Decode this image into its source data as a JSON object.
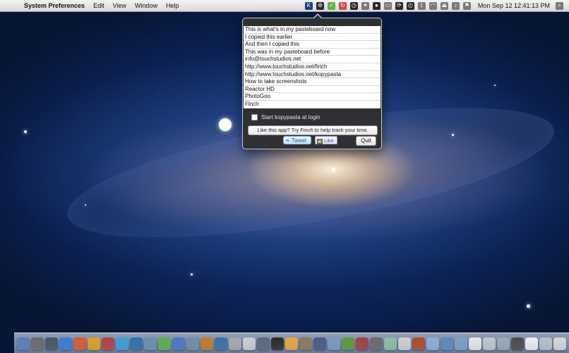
{
  "menubar": {
    "apple_symbol": "",
    "app_name": "System Preferences",
    "menus": [
      "Edit",
      "View",
      "Window",
      "Help"
    ],
    "status_icons": [
      "kopypasta-icon",
      "gear-icon",
      "check-icon",
      "refresh-icon",
      "clock-icon",
      "tools-icon",
      "bubble-icon",
      "window-icon",
      "sync-icon",
      "timemachine-icon",
      "bluetooth-icon",
      "wifi-icon",
      "eject-icon",
      "volume-icon",
      "flag-icon"
    ],
    "datetime": "Mon Sep 12  12:41:13 PM",
    "search_icon": "spotlight-icon"
  },
  "popover": {
    "clipboard_items": [
      "This is what's in my pasteboard now",
      "I copied this earlier",
      "And then I copied this",
      "This was in my pasteboard before",
      "info@touchstudios.net",
      "http://www.touchstudios.net/finch",
      "http://www.touchstudios.net/kopypasta",
      "How to take screenshots",
      "Reactor HD",
      "PhotoGoo",
      "Finch"
    ],
    "start_at_login_label": "Start kopypasta at login",
    "start_at_login_checked": false,
    "promo_label": "Like this app? Try Finch to help track your time.",
    "tweet_label": "Tweet",
    "like_label": "Like",
    "quit_label": "Quit"
  },
  "dock": {
    "icon_colors": [
      "#5a7fb8",
      "#6b6b6b",
      "#445566",
      "#3a7bd5",
      "#d8583a",
      "#e0a020",
      "#b64040",
      "#3aa0d8",
      "#2f6fb0",
      "#6a8fb0",
      "#5bb04b",
      "#4a78c0",
      "#6f8fa8",
      "#c47b2a",
      "#3a6ea5",
      "#a8a8a8",
      "#cfcfcf",
      "#5a6a7a",
      "#2a2a2a",
      "#e6a83a",
      "#8a7a5a",
      "#4a5a8a",
      "#7a9ac0",
      "#5a9a3a",
      "#a04040",
      "#6a6a6a",
      "#8ac0a0",
      "#d0d0d0",
      "#b04a2a",
      "#8ab0d8",
      "#5a8ac0",
      "#7aa0c8",
      "#e8e8e8",
      "#c0c8d0",
      "#9aa8b8",
      "#4a4a4a",
      "#f0f0f0",
      "#b8c0c8",
      "#d8d8d8"
    ]
  },
  "colors": {
    "popover_bg": "#2f3034",
    "menubar_bg": "#e6e6e6",
    "desktop_bg": "#0f2b66"
  }
}
